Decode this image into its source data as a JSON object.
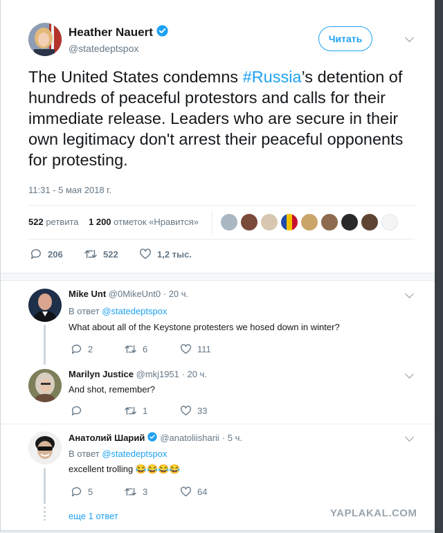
{
  "tweet": {
    "author_name": "Heather Nauert",
    "handle": "@statedeptspox",
    "follow_label": "Читать",
    "text_before": "The United States condemns ",
    "hashtag": "#Russia",
    "text_after": "’s detention of hundreds of peaceful protestors and calls for their immediate release. Leaders who are secure in their own legitimacy don't arrest their peaceful opponents for protesting.",
    "timestamp": "11:31 - 5 мая 2018 г.",
    "retweets_count": "522",
    "retweets_label": "ретвита",
    "likes_count": "1 200",
    "likes_label": "отметок «Нравится»",
    "replies": "206",
    "retweets": "522",
    "likes": "1,2 тыс."
  },
  "replies": [
    {
      "name": "Mike Unt",
      "handle": "@0MikeUnt0",
      "time": "· 20 ч.",
      "reply_prefix": "В ответ",
      "reply_to": "@statedeptspox",
      "text": "What about all of the Keystone protesters we hosed down in winter?",
      "replies": "2",
      "retweets": "6",
      "likes": "111"
    },
    {
      "name": "Marilyn Justice",
      "handle": "@mkj1951",
      "time": "· 20 ч.",
      "text": "And shot, remember?",
      "retweets": "1",
      "likes": "33"
    },
    {
      "name": "Анатолий Шарий",
      "handle": "@anatoliisharii",
      "time": "· 5 ч.",
      "reply_prefix": "В ответ",
      "reply_to": "@statedeptspox",
      "text": "excellent trolling 😂😂😂😂",
      "replies": "5",
      "retweets": "3",
      "likes": "64",
      "more": "еще 1 ответ"
    }
  ],
  "watermark": "YAPLAKAL.COM",
  "colors": {
    "accent": "#1da1f2",
    "muted": "#657786",
    "verified": "#1da1f2"
  }
}
